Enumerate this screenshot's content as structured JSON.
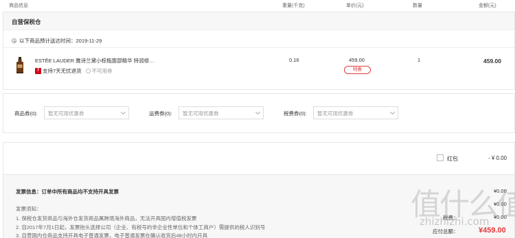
{
  "header": {
    "product_info": "商品信息",
    "weight": "重量(千克)",
    "unit_price": "单价(元)",
    "quantity": "数量",
    "amount": "金额(元)"
  },
  "warehouse": {
    "title": "自营保税仓",
    "delivery_notice": "以下商品预计送达时间：2019-11-29"
  },
  "product": {
    "name": "ESTĒE LAUDER 雅诗兰黛小棕瓶面部精华 特润修…",
    "return_badge": "7",
    "return_policy": "支持7天无忧退货",
    "coupon_status": "不可用券",
    "weight": "0.16",
    "unit_price": "459.00",
    "tag": "特惠",
    "quantity": "1",
    "amount": "459.00"
  },
  "coupons": [
    {
      "label": "商品券(0):",
      "placeholder": "暂无可用优惠券"
    },
    {
      "label": "运费券(0):",
      "placeholder": "暂无可用优惠券"
    },
    {
      "label": "税费券(0):",
      "placeholder": "暂无可用优惠券"
    }
  ],
  "red_packet": {
    "label": "红包",
    "value": "- ¥ 0.00"
  },
  "invoice": {
    "info": "发票信息：订单中所有商品均不支持开具发票",
    "notes_title": "发票须知：",
    "notes": [
      "1. 保税仓发货商品与海外仓发货商品属跨境海外商品，无法开具国内增值税发票",
      "2. 自2017年7月1日起，发票抬头选择公司（企业、有税号的非企业性单位和个体工商户）需提供的税人识别号",
      "3. 自营国内仓商品支持开具电子普通发票，电子普通发票在确认收货后48小时内开具"
    ]
  },
  "summary": {
    "tax_label": "税费：",
    "tax_value": "¥0.00",
    "coupon_value": "¥0.00",
    "shipping_value": "¥0.00",
    "total_label": "应付总额：",
    "total_value": "¥459.00"
  },
  "watermark": {
    "text": "值什么值",
    "url": "zhizhizhi.com"
  },
  "colors": {
    "accent_red": "#e4393c",
    "badge_red": "#d0021b"
  }
}
